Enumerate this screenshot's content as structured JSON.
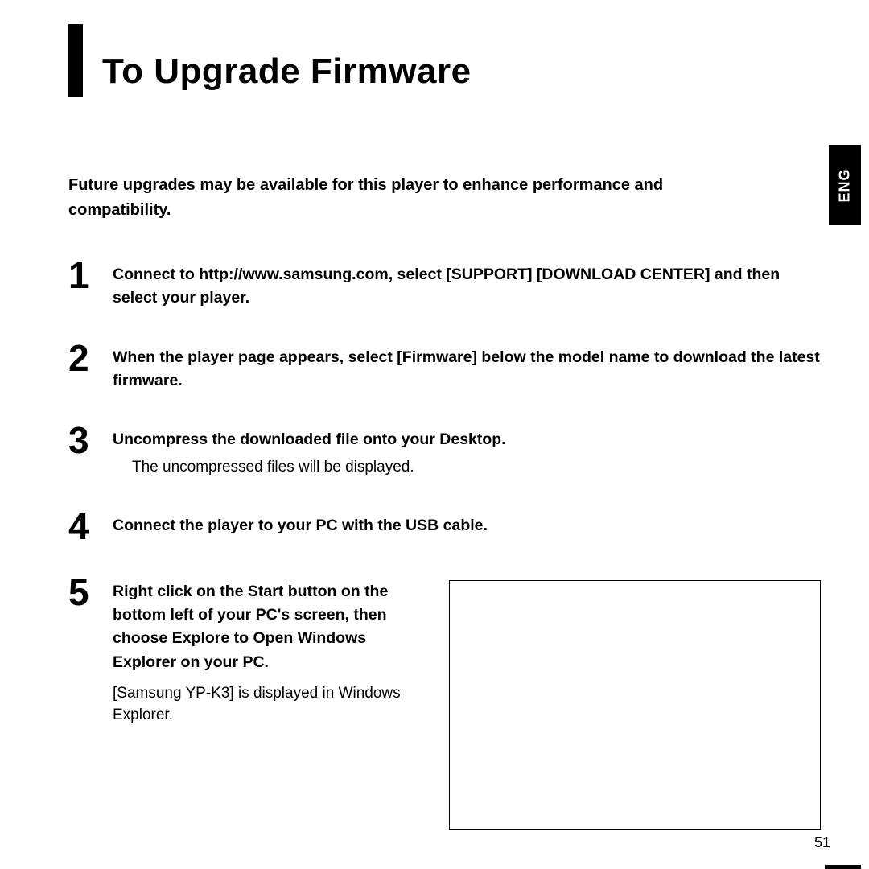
{
  "lang_tab": "ENG",
  "title": "To Upgrade Firmware",
  "intro": "Future upgrades may be available for this player to enhance performance and compatibility.",
  "steps": {
    "s1": {
      "num": "1",
      "text": "Connect to http://www.samsung.com, select [SUPPORT]     [DOWNLOAD CENTER] and then select your player."
    },
    "s2": {
      "num": "2",
      "text": "When the player page appears, select [Firmware] below the model name to download the latest firmware."
    },
    "s3": {
      "num": "3",
      "text": "Uncompress the downloaded file onto your Desktop.",
      "sub": "The uncompressed files will be displayed."
    },
    "s4": {
      "num": "4",
      "text": "Connect the player to your PC with the USB cable."
    },
    "s5": {
      "num": "5",
      "text": "Right click on the Start button on the bottom left of your PC's screen, then choose Explore to Open Windows Explorer on your PC.",
      "sub": "[Samsung YP-K3] is displayed in Windows Explorer."
    }
  },
  "page_number": "51"
}
